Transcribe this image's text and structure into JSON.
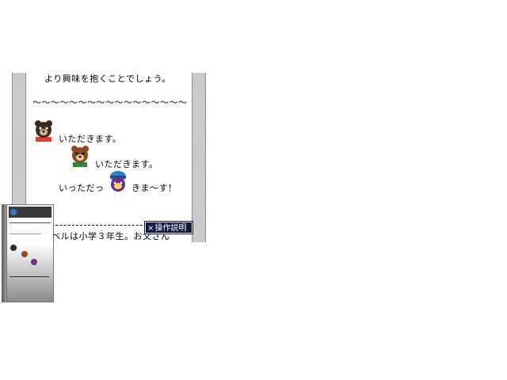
{
  "reader": {
    "line1": "より興味を抱くことでしょう。",
    "tilde_line": "〜〜〜〜〜〜〜〜〜〜〜〜〜〜〜〜〜",
    "speech1": "いただきます。",
    "speech2": "いただきます。",
    "speech3_a": "いっただっ",
    "speech3_b": "きま〜す！",
    "bottom_line": "ベルは小学３年生。お父さん"
  },
  "help_button": {
    "icon": "×",
    "label": "操作説明"
  },
  "book": {
    "title": "",
    "icons": [
      "dark-bear-face-icon",
      "brown-bear-face-icon",
      "purple-creature-icon"
    ],
    "colors": {
      "dark_bear": "#3a2a1e",
      "brown_bear": "#8b4a20",
      "creature_blue": "#2e7bd1",
      "creature_purple": "#6b2c8c"
    }
  }
}
